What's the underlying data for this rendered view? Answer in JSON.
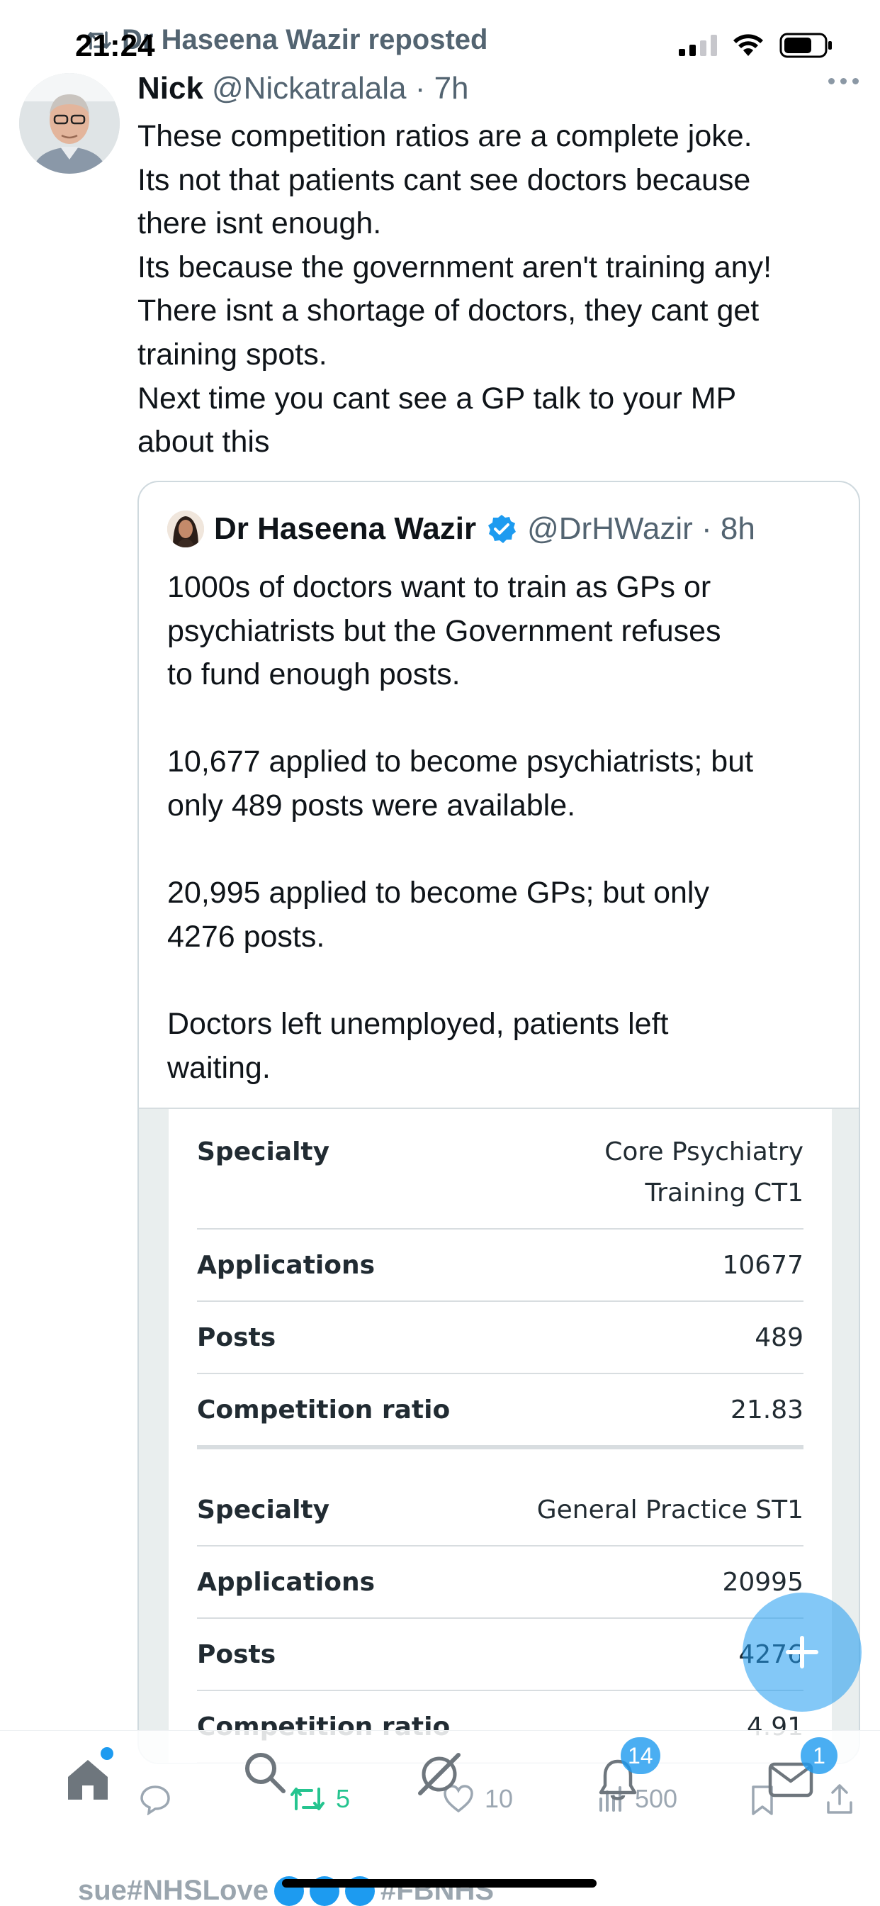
{
  "status_bar": {
    "time": "21:24",
    "signal_bars_active": 2,
    "battery_level": 0.6
  },
  "repost": {
    "label": "Dr Haseena Wazir reposted",
    "icon": "repost-icon"
  },
  "tweet": {
    "author_name": "Nick",
    "author_meta": "@Nickatralala · 7h",
    "more_icon": "more-icon",
    "lines": [
      "These competition ratios are a complete joke.",
      "Its not that patients cant see doctors because",
      "there isnt enough.",
      "Its because the government aren't training any!",
      "There isnt a shortage of doctors, they cant get",
      "training spots.",
      "Next time you cant see a GP talk to your MP",
      "about this"
    ]
  },
  "quote": {
    "author_name": "Dr Haseena Wazir",
    "verified_icon": "verified-badge-icon",
    "author_meta": "@DrHWazir · 8h",
    "paragraphs": [
      [
        "1000s of doctors want to train as GPs or",
        "psychiatrists but the Government refuses",
        "to fund enough posts."
      ],
      [
        "10,677 applied to become psychiatrists; but",
        "only 489 posts were available."
      ],
      [
        "20,995 applied to become GPs; but only",
        "4276 posts."
      ],
      [
        "Doctors left unemployed, patients left",
        "waiting."
      ]
    ],
    "table_groups": [
      {
        "rows": [
          {
            "key": "Specialty",
            "value_lines": [
              "Core Psychiatry",
              "Training CT1"
            ]
          },
          {
            "key": "Applications",
            "value_lines": [
              "10677"
            ]
          },
          {
            "key": "Posts",
            "value_lines": [
              "489"
            ]
          },
          {
            "key": "Competition ratio",
            "value_lines": [
              "21.83"
            ]
          }
        ]
      },
      {
        "rows": [
          {
            "key": "Specialty",
            "value_lines": [
              "General Practice ST1"
            ]
          },
          {
            "key": "Applications",
            "value_lines": [
              "20995"
            ]
          },
          {
            "key": "Posts",
            "value_lines": [
              "4276"
            ]
          },
          {
            "key": "Competition ratio",
            "value_lines": [
              "4.91"
            ]
          }
        ]
      }
    ]
  },
  "actions": {
    "reply_icon": "reply-icon",
    "retweet_count": "5",
    "like_count": "10",
    "views_count": "500",
    "bookmark_icon": "bookmark-icon",
    "share_icon": "share-icon",
    "retweet_color": "#00ba7c"
  },
  "tabbar": {
    "home_icon": "home-icon",
    "search_icon": "search-icon",
    "grok_icon": "grok-icon",
    "notifications_badge": "14",
    "messages_badge": "1",
    "accent": "#1d9bf0"
  },
  "next_tweet_preview": {
    "text_start": "sue#NHSLove",
    "text_end": "#FBNHS"
  },
  "fab": {
    "icon": "compose-plus-icon"
  }
}
